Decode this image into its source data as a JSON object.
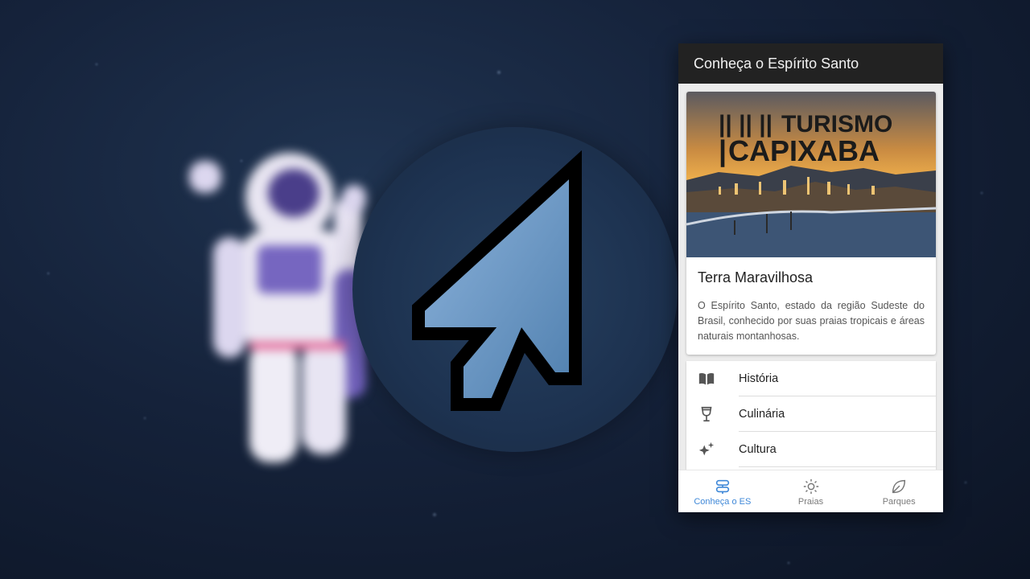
{
  "app": {
    "title": "Conheça o Espírito Santo"
  },
  "card": {
    "image_text_line1": "TURISMO",
    "image_text_line2": "CAPIXABA",
    "title": "Terra Maravilhosa",
    "description": "O Espírito Santo, estado da região Sudeste do Brasil, conhecido por suas praias tropicais e áreas naturais montanhosas."
  },
  "menu": {
    "items": [
      {
        "label": "História",
        "icon": "book-icon"
      },
      {
        "label": "Culinária",
        "icon": "wine-glass-icon"
      },
      {
        "label": "Cultura",
        "icon": "sparkles-icon"
      }
    ]
  },
  "tabs": [
    {
      "label": "Conheça o ES",
      "icon": "signpost-icon",
      "active": true
    },
    {
      "label": "Praias",
      "icon": "sun-icon",
      "active": false
    },
    {
      "label": "Parques",
      "icon": "leaf-icon",
      "active": false
    }
  ],
  "colors": {
    "appbar": "#222222",
    "accent": "#3f88d8",
    "background": "#15223a"
  }
}
